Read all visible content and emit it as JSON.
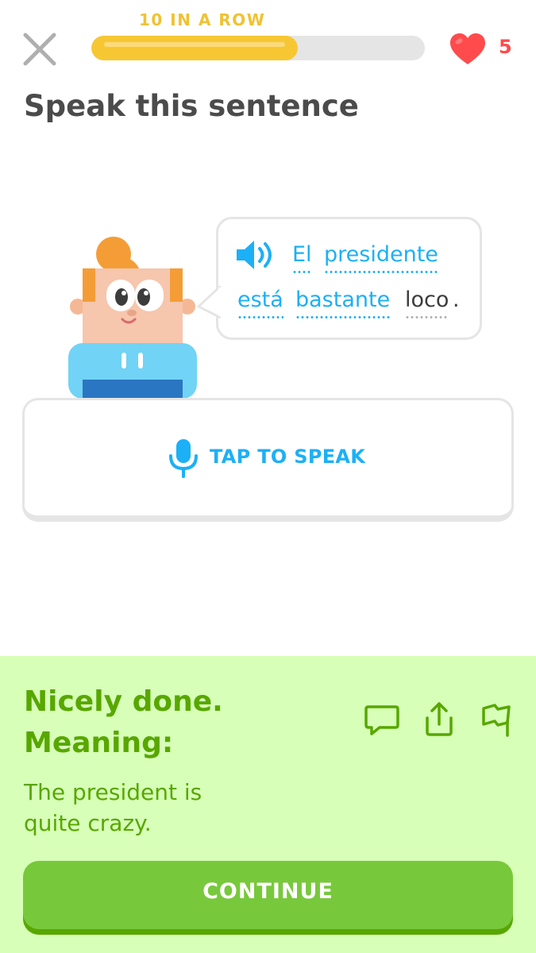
{
  "header": {
    "streak_label": "10 IN A ROW",
    "progress_fraction": 0.62,
    "hearts": "5",
    "close_icon": "close-icon",
    "heart_icon": "heart-icon"
  },
  "prompt": {
    "title": "Speak this sentence",
    "speaker_icon": "speaker-icon",
    "words": [
      "El",
      "presidente",
      "está",
      "bastante",
      "loco"
    ],
    "punctuation": "."
  },
  "speak_button": {
    "label": "TAP TO SPEAK",
    "icon": "microphone-icon"
  },
  "feedback": {
    "title_line1": "Nicely done.",
    "title_line2": "Meaning:",
    "meaning": "The president is quite crazy.",
    "icons": [
      "comment-icon",
      "share-icon",
      "flag-icon"
    ],
    "continue_label": "CONTINUE"
  },
  "colors": {
    "accent_blue": "#1cb0f6",
    "success_green": "#58a700",
    "success_bg": "#d7ffb8",
    "button_green": "#78c83c",
    "streak_yellow": "#f0c232",
    "heart_red": "#ff4b4b"
  }
}
